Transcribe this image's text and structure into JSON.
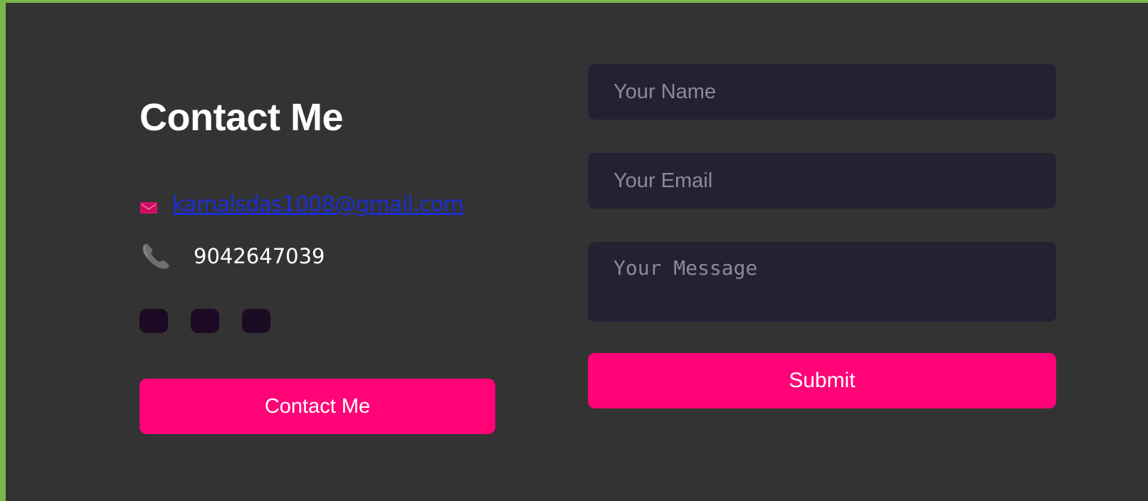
{
  "contact": {
    "title": "Contact Me",
    "email": "kamalsdas1008@gmail.com",
    "phone": "9042647039",
    "email_icon": "envelope-icon",
    "phone_icon": "telephone-icon",
    "contact_button_label": "Contact Me"
  },
  "socials": {
    "count": 3
  },
  "form": {
    "name_placeholder": "Your Name",
    "email_placeholder": "Your Email",
    "message_placeholder": "Your Message",
    "submit_label": "Submit"
  },
  "colors": {
    "page_border": "#7ab648",
    "panel_background": "#333333",
    "accent": "#ff0377",
    "field_background": "#232233",
    "link": "#1a2fd6",
    "social_button": "#1c0a24"
  }
}
